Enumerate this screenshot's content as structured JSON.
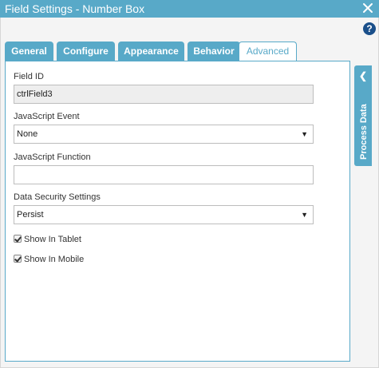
{
  "window": {
    "title": "Field Settings - Number Box"
  },
  "tabs": [
    {
      "label": "General"
    },
    {
      "label": "Configure"
    },
    {
      "label": "Appearance"
    },
    {
      "label": "Behavior"
    },
    {
      "label": "Advanced",
      "active": true
    }
  ],
  "form": {
    "field_id": {
      "label": "Field ID",
      "value": "ctrlField3"
    },
    "js_event": {
      "label": "JavaScript Event",
      "value": "None"
    },
    "js_function": {
      "label": "JavaScript Function",
      "value": ""
    },
    "data_security": {
      "label": "Data Security Settings",
      "value": "Persist"
    },
    "show_in_tablet": {
      "label": "Show In Tablet",
      "checked": true
    },
    "show_in_mobile": {
      "label": "Show In Mobile",
      "checked": true
    }
  },
  "side_panel": {
    "label": "Process Data"
  },
  "icons": {
    "close": "close-icon",
    "help": "help-icon",
    "collapse": "chevron-left-icon",
    "dropdown": "caret-down-icon"
  },
  "colors": {
    "accent": "#58a9c8",
    "help": "#1a4f8a"
  }
}
